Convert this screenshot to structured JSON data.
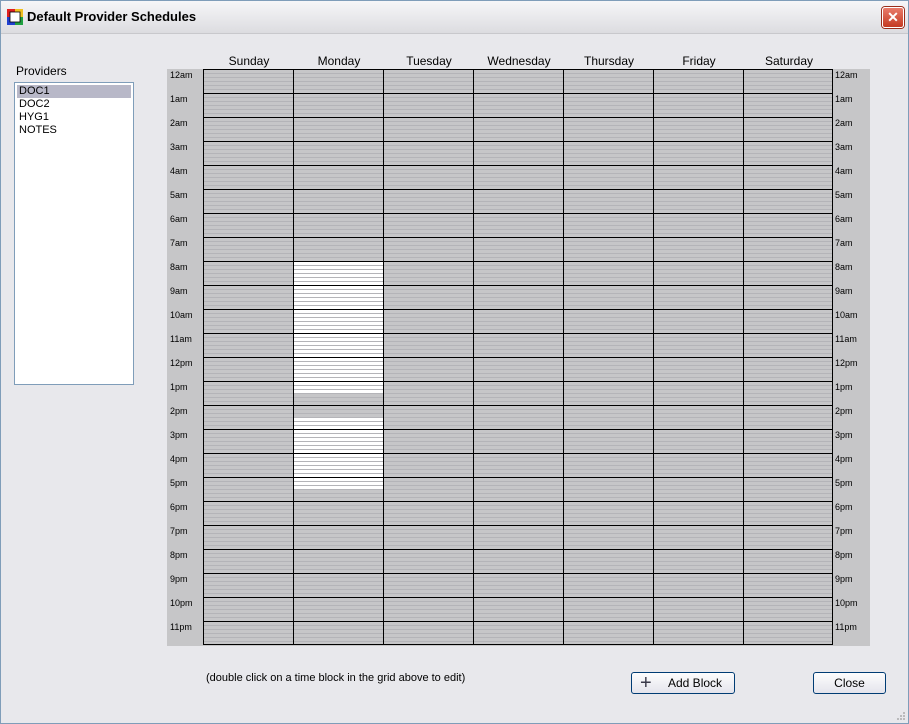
{
  "window": {
    "title": "Default Provider Schedules",
    "close_glyph": "✕"
  },
  "providers": {
    "label": "Providers",
    "items": [
      "DOC1",
      "DOC2",
      "HYG1",
      "NOTES"
    ],
    "selected": "DOC1"
  },
  "schedule": {
    "days": [
      "Sunday",
      "Monday",
      "Tuesday",
      "Wednesday",
      "Thursday",
      "Friday",
      "Saturday"
    ],
    "hours": [
      "12am",
      "1am",
      "2am",
      "3am",
      "4am",
      "5am",
      "6am",
      "7am",
      "8am",
      "9am",
      "10am",
      "11am",
      "12pm",
      "1pm",
      "2pm",
      "3pm",
      "4pm",
      "5pm",
      "6pm",
      "7pm",
      "8pm",
      "9pm",
      "10pm",
      "11pm"
    ],
    "blocks": [
      {
        "day": "Monday",
        "start": "8:00am",
        "end": "1:30pm"
      },
      {
        "day": "Monday",
        "start": "2:30pm",
        "end": "5:30pm"
      }
    ],
    "colors": {
      "closed": "#c6c6c8",
      "open": "#ffffff",
      "line": "#b4b4b8",
      "hour_line": "#000000"
    }
  },
  "footer": {
    "hint": "(double click on a time block in the grid above to edit)",
    "add_block_label": "Add Block",
    "close_label": "Close",
    "add_icon": "plus-icon"
  }
}
